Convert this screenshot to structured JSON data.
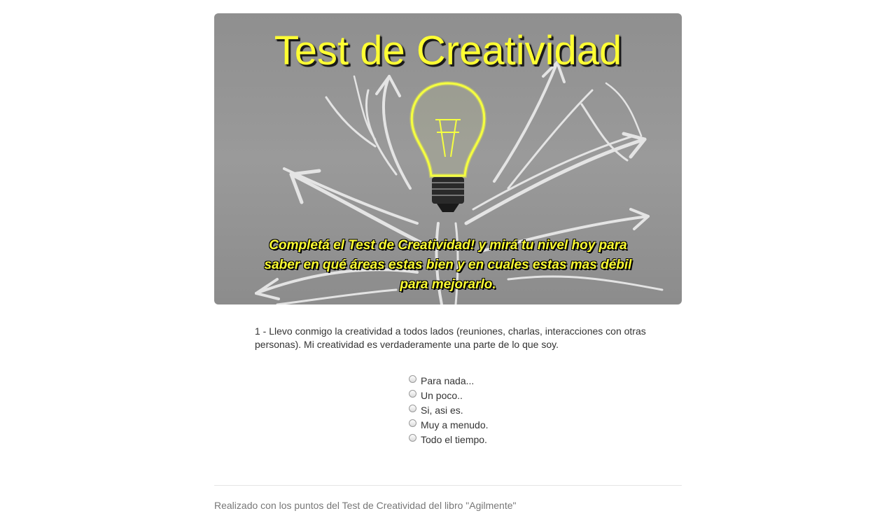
{
  "hero": {
    "title": "Test de Creatividad",
    "subtitle": "Completá el Test de Creatividad! y mirá tu nivel hoy para saber en qué áreas estas bien y en cuales estas mas débil para mejorarlo."
  },
  "question": {
    "text": "1 - Llevo conmigo la creatividad a todos lados (reuniones, charlas, interacciones con otras personas). Mi creatividad es verdaderamente una parte de lo que soy."
  },
  "options": [
    {
      "label": "Para nada..."
    },
    {
      "label": "Un poco.."
    },
    {
      "label": "Si, asi es."
    },
    {
      "label": "Muy a menudo."
    },
    {
      "label": "Todo el tiempo."
    }
  ],
  "footer": {
    "text": "Realizado con los puntos del Test de Creatividad del libro \"Agilmente\""
  },
  "colors": {
    "title_yellow": "#ffff33",
    "hero_background": "#959595",
    "footer_text": "#777777"
  }
}
